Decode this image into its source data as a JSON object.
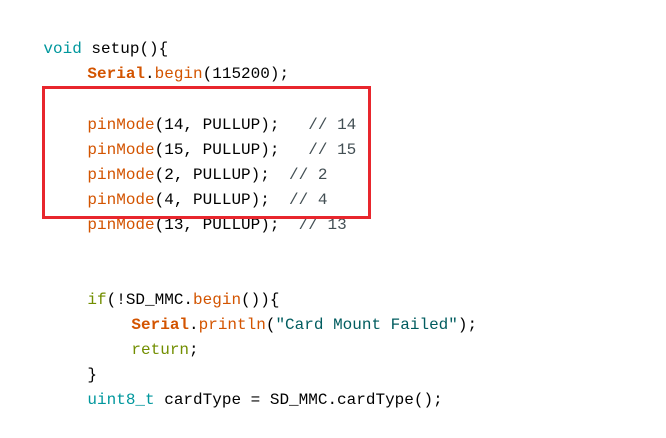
{
  "code": {
    "line1": {
      "type": "void",
      "fn": "setup",
      "punct": "(){"
    },
    "line2": {
      "obj": "Serial",
      "dot": ".",
      "fn": "begin",
      "args": "(115200);"
    },
    "pins": [
      {
        "fn": "pinMode",
        "args": "(14, PULLUP);",
        "gap": "   ",
        "comment": "// 14"
      },
      {
        "fn": "pinMode",
        "args": "(15, PULLUP);",
        "gap": "   ",
        "comment": "// 15"
      },
      {
        "fn": "pinMode",
        "args": "(2, PULLUP);",
        "gap": "  ",
        "comment": "// 2"
      },
      {
        "fn": "pinMode",
        "args": "(4, PULLUP);",
        "gap": "  ",
        "comment": "// 4"
      },
      {
        "fn": "pinMode",
        "args": "(13, PULLUP);",
        "gap": "  ",
        "comment": "// 13"
      }
    ],
    "if_line": {
      "kw": "if",
      "open": "(!SD_MMC.",
      "fn": "begin",
      "close": "()){"
    },
    "println_line": {
      "obj": "Serial",
      "dot": ".",
      "fn": "println",
      "open": "(",
      "str": "\"Card Mount Failed\"",
      "close": ");"
    },
    "return_line": {
      "kw": "return",
      "semi": ";"
    },
    "close_brace": "}",
    "card_line": {
      "type": "uint8_t",
      "rest": " cardType = SD_MMC.cardType();"
    }
  },
  "colors": {
    "highlight_border": "#e8262d",
    "type_keyword": "#00979d",
    "function": "#d35400",
    "control_keyword": "#728e00",
    "string": "#005c5f",
    "comment": "#434f54"
  }
}
